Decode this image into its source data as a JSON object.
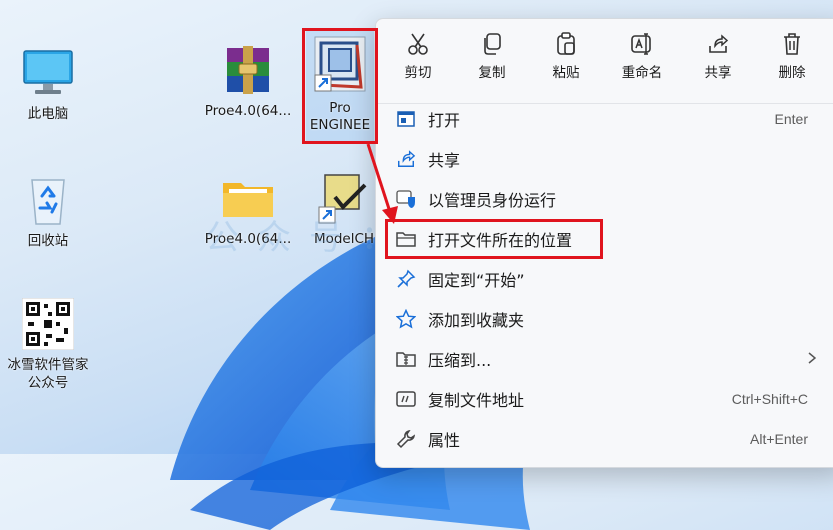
{
  "desktop": {
    "icons": [
      {
        "label": "此电脑",
        "icon": "monitor-icon"
      },
      {
        "label": "回收站",
        "icon": "recycle-bin-icon"
      },
      {
        "label": "冰雪软件管家\n公众号",
        "icon": "qr-code-icon"
      },
      {
        "label": "Proe4.0(64...",
        "icon": "winrar-archive-icon"
      },
      {
        "label": "Proe4.0(64...",
        "icon": "folder-icon"
      },
      {
        "label": "Pro\nENGINEE",
        "icon": "pro-engineer-shortcut-icon"
      },
      {
        "label": "ModelCH",
        "icon": "modelcheck-shortcut-icon"
      }
    ],
    "watermark": "公众号：冰雪软件库"
  },
  "context_menu": {
    "toolbar": [
      {
        "label": "剪切",
        "icon": "scissors-icon"
      },
      {
        "label": "复制",
        "icon": "copy-icon"
      },
      {
        "label": "粘贴",
        "icon": "paste-icon"
      },
      {
        "label": "重命名",
        "icon": "rename-icon"
      },
      {
        "label": "共享",
        "icon": "share-icon"
      },
      {
        "label": "删除",
        "icon": "trash-icon"
      }
    ],
    "items": [
      {
        "label": "打开",
        "shortcut": "Enter",
        "icon": "app-window-icon"
      },
      {
        "label": "共享",
        "shortcut": "",
        "icon": "share-icon"
      },
      {
        "label": "以管理员身份运行",
        "shortcut": "",
        "icon": "admin-shield-icon"
      },
      {
        "label": "打开文件所在的位置",
        "shortcut": "",
        "icon": "folder-icon"
      },
      {
        "label": "固定到“开始”",
        "shortcut": "",
        "icon": "pin-icon"
      },
      {
        "label": "添加到收藏夹",
        "shortcut": "",
        "icon": "star-icon"
      },
      {
        "label": "压缩到...",
        "shortcut": "",
        "icon": "zip-folder-icon"
      },
      {
        "label": "复制文件地址",
        "shortcut": "Ctrl+Shift+C",
        "icon": "copy-path-icon"
      },
      {
        "label": "属性",
        "shortcut": "Alt+Enter",
        "icon": "wrench-icon"
      }
    ]
  },
  "colors": {
    "highlight": "#e0141e",
    "accent": "#1a6fd8"
  }
}
